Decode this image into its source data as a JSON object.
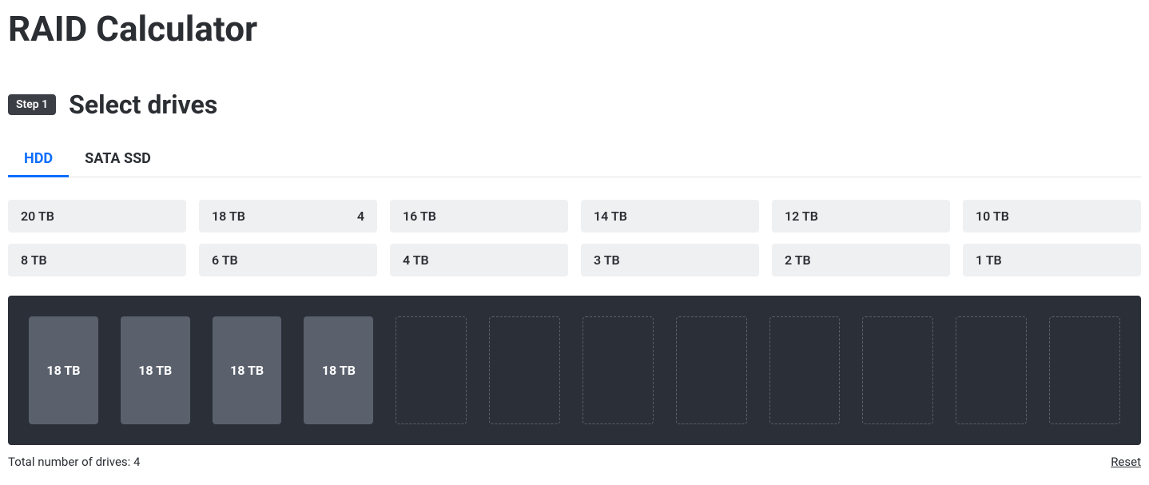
{
  "page": {
    "title": "RAID Calculator"
  },
  "step": {
    "badge": "Step 1",
    "title": "Select drives"
  },
  "tabs": {
    "hdd": "HDD",
    "sata_ssd": "SATA SSD",
    "active": "hdd"
  },
  "capacities": [
    {
      "label": "20 TB",
      "count": ""
    },
    {
      "label": "18 TB",
      "count": "4"
    },
    {
      "label": "16 TB",
      "count": ""
    },
    {
      "label": "14 TB",
      "count": ""
    },
    {
      "label": "12 TB",
      "count": ""
    },
    {
      "label": "10 TB",
      "count": ""
    },
    {
      "label": "8 TB",
      "count": ""
    },
    {
      "label": "6 TB",
      "count": ""
    },
    {
      "label": "4 TB",
      "count": ""
    },
    {
      "label": "3 TB",
      "count": ""
    },
    {
      "label": "2 TB",
      "count": ""
    },
    {
      "label": "1 TB",
      "count": ""
    }
  ],
  "bays": [
    {
      "filled": true,
      "label": "18 TB"
    },
    {
      "filled": true,
      "label": "18 TB"
    },
    {
      "filled": true,
      "label": "18 TB"
    },
    {
      "filled": true,
      "label": "18 TB"
    },
    {
      "filled": false,
      "label": ""
    },
    {
      "filled": false,
      "label": ""
    },
    {
      "filled": false,
      "label": ""
    },
    {
      "filled": false,
      "label": ""
    },
    {
      "filled": false,
      "label": ""
    },
    {
      "filled": false,
      "label": ""
    },
    {
      "filled": false,
      "label": ""
    },
    {
      "filled": false,
      "label": ""
    }
  ],
  "footer": {
    "total_label_prefix": "Total number of drives: ",
    "total_value": "4",
    "reset": "Reset"
  }
}
